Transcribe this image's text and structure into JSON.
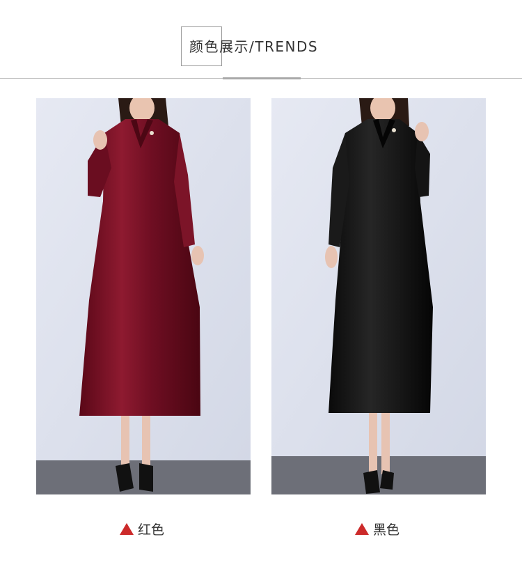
{
  "header": {
    "title": "颜色展示/TRENDS"
  },
  "colors": {
    "accent_triangle": "#cc2a2a",
    "wall": "#dfe3ef",
    "floor": "#6d6f78",
    "dress_red": "#7a0f24",
    "dress_black": "#141414"
  },
  "variants": [
    {
      "label": "红色",
      "icon": "triangle-up-icon",
      "dress_color": "#7a0f24"
    },
    {
      "label": "黑色",
      "icon": "triangle-up-icon",
      "dress_color": "#141414"
    }
  ]
}
